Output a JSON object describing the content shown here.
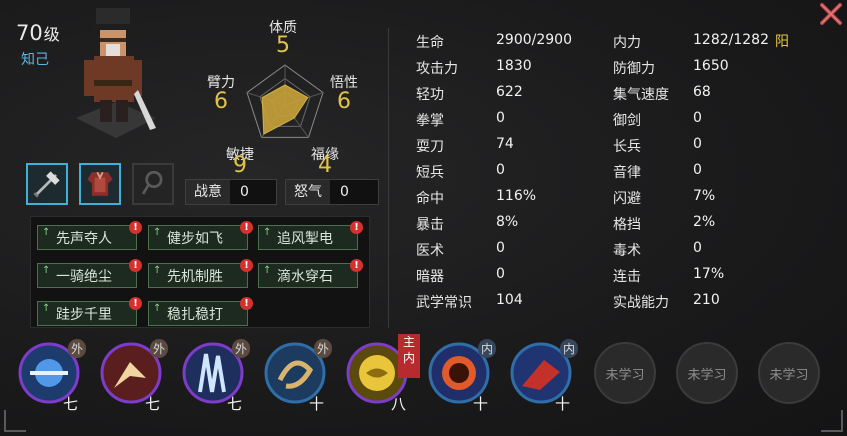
{
  "character": {
    "level": "70",
    "level_unit": "级",
    "relation": "知己"
  },
  "radar": {
    "attrs": [
      {
        "name": "体质",
        "value": "5"
      },
      {
        "name": "悟性",
        "value": "6"
      },
      {
        "name": "福缘",
        "value": "4"
      },
      {
        "name": "敏捷",
        "value": "9"
      },
      {
        "name": "臂力",
        "value": "6"
      }
    ],
    "fill_fractions": [
      0.5,
      0.6,
      0.4,
      0.9,
      0.6
    ],
    "color": "#e2c248"
  },
  "equipment": [
    {
      "icon": "axe-icon",
      "state": "equipped"
    },
    {
      "icon": "armor-icon",
      "state": "equipped"
    },
    {
      "icon": "accessory-icon",
      "state": "empty"
    }
  ],
  "meters": {
    "zhanyi_label": "战意",
    "zhanyi_value": "0",
    "nuqi_label": "怒气",
    "nuqi_value": "0"
  },
  "talents": [
    "先声夺人",
    "健步如飞",
    "追风掣电",
    "一骑绝尘",
    "先机制胜",
    "滴水穿石",
    "跬步千里",
    "稳扎稳打"
  ],
  "attributes_left": [
    {
      "k": "生命",
      "v": "2900/2900"
    },
    {
      "k": "攻击力",
      "v": "1830"
    },
    {
      "k": "轻功",
      "v": "622"
    },
    {
      "k": "拳掌",
      "v": "0"
    },
    {
      "k": "耍刀",
      "v": "74"
    },
    {
      "k": "短兵",
      "v": "0"
    },
    {
      "k": "命中",
      "v": "116%"
    },
    {
      "k": "暴击",
      "v": "8%"
    },
    {
      "k": "医术",
      "v": "0"
    },
    {
      "k": "暗器",
      "v": "0"
    },
    {
      "k": "武学常识",
      "v": "104"
    }
  ],
  "attributes_right": [
    {
      "k": "内力",
      "v": "1282/1282"
    },
    {
      "k": "防御力",
      "v": "1650"
    },
    {
      "k": "集气速度",
      "v": "68"
    },
    {
      "k": "御剑",
      "v": "0"
    },
    {
      "k": "长兵",
      "v": "0"
    },
    {
      "k": "音律",
      "v": "0"
    },
    {
      "k": "闪避",
      "v": "7%"
    },
    {
      "k": "格挡",
      "v": "2%"
    },
    {
      "k": "毒术",
      "v": "0"
    },
    {
      "k": "连击",
      "v": "17%"
    },
    {
      "k": "实战能力",
      "v": "210"
    }
  ],
  "neili_type": "阳",
  "skills": [
    {
      "tag": "外",
      "level": "七",
      "colors": [
        "#1e3b6e",
        "#5aa9ff"
      ]
    },
    {
      "tag": "外",
      "level": "七",
      "colors": [
        "#5a1e1e",
        "#f0d5a0"
      ]
    },
    {
      "tag": "外",
      "level": "七",
      "colors": [
        "#1e2f5e",
        "#cfe6ff"
      ]
    },
    {
      "tag": "外",
      "level": "十",
      "colors": [
        "#1d3b5f",
        "#d9b46c"
      ]
    },
    {
      "tag": "主内",
      "level": "八",
      "colors": [
        "#5a4a0e",
        "#e8c53a"
      ]
    },
    {
      "tag": "内",
      "level": "十",
      "colors": [
        "#202f6a",
        "#e05a2a"
      ]
    },
    {
      "tag": "内",
      "level": "十",
      "colors": [
        "#1f3470",
        "#c4312a"
      ]
    }
  ],
  "locked_skill_label": "未学习"
}
